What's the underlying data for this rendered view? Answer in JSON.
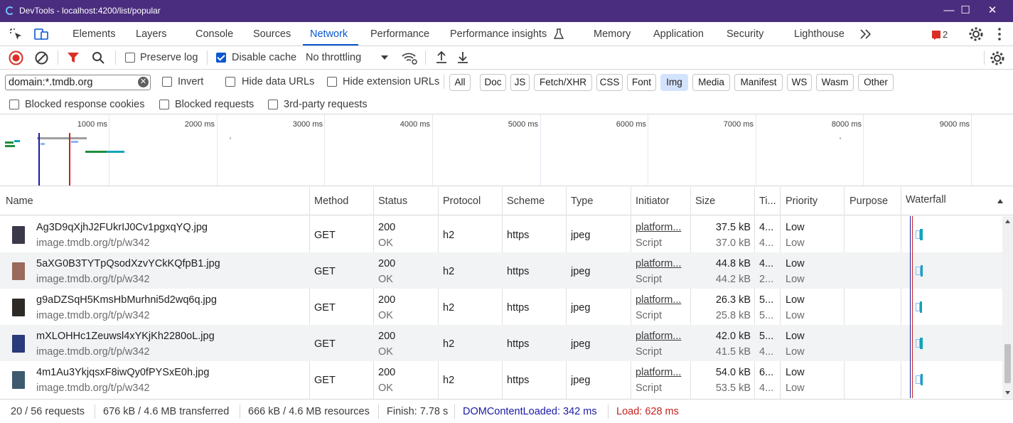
{
  "window": {
    "title": "DevTools - localhost:4200/list/popular",
    "minimize_glyph": "—",
    "maximize_glyph": "☐",
    "close_glyph": "✕"
  },
  "tabs": [
    "Elements",
    "Layers",
    "Console",
    "Sources",
    "Network",
    "Performance",
    "Performance insights",
    "Memory",
    "Application",
    "Security",
    "Lighthouse"
  ],
  "active_tab": "Network",
  "issues_count": "2",
  "toolbar": {
    "preserve_log": "Preserve log",
    "preserve_log_checked": false,
    "disable_cache": "Disable cache",
    "disable_cache_checked": true,
    "throttling": "No throttling"
  },
  "filter": {
    "value": "domain:*.tmdb.org",
    "invert": "Invert",
    "hide_data_urls": "Hide data URLs",
    "hide_extension_urls": "Hide extension URLs",
    "types": [
      "All",
      "Doc",
      "JS",
      "Fetch/XHR",
      "CSS",
      "Font",
      "Img",
      "Media",
      "Manifest",
      "WS",
      "Wasm",
      "Other"
    ],
    "active_type": "Img",
    "blocked_response_cookies": "Blocked response cookies",
    "blocked_requests": "Blocked requests",
    "third_party_requests": "3rd-party requests"
  },
  "overview": {
    "ticks": [
      "1000 ms",
      "2000 ms",
      "3000 ms",
      "4000 ms",
      "5000 ms",
      "6000 ms",
      "7000 ms",
      "8000 ms",
      "9000 ms"
    ],
    "dom_content_loaded_ms": 342,
    "load_ms": 628
  },
  "columns": [
    "Name",
    "Method",
    "Status",
    "Protocol",
    "Scheme",
    "Type",
    "Initiator",
    "Size",
    "Ti...",
    "Priority",
    "Purpose",
    "Waterfall"
  ],
  "requests": [
    {
      "name": "Ag3D9qXjhJ2FUkrIJ0Cv1pgxqYQ.jpg",
      "url": "image.tmdb.org/t/p/w342",
      "method": "GET",
      "status": "200",
      "status_text": "OK",
      "protocol": "h2",
      "scheme": "https",
      "type": "jpeg",
      "initiator": "platform...",
      "initiator_type": "Script",
      "size": "37.5 kB",
      "resource_size": "37.0 kB",
      "time": "4...",
      "time2": "4...",
      "priority": "Low",
      "priority2": "Low",
      "thumb_color": "#3a3a4a"
    },
    {
      "name": "5aXG0B3TYTpQsodXzvYCkKQfpB1.jpg",
      "url": "image.tmdb.org/t/p/w342",
      "method": "GET",
      "status": "200",
      "status_text": "OK",
      "protocol": "h2",
      "scheme": "https",
      "type": "jpeg",
      "initiator": "platform...",
      "initiator_type": "Script",
      "size": "44.8 kB",
      "resource_size": "44.2 kB",
      "time": "4...",
      "time2": "2...",
      "priority": "Low",
      "priority2": "Low",
      "thumb_color": "#9a6a5a"
    },
    {
      "name": "g9aDZSqH5KmsHbMurhni5d2wq6q.jpg",
      "url": "image.tmdb.org/t/p/w342",
      "method": "GET",
      "status": "200",
      "status_text": "OK",
      "protocol": "h2",
      "scheme": "https",
      "type": "jpeg",
      "initiator": "platform...",
      "initiator_type": "Script",
      "size": "26.3 kB",
      "resource_size": "25.8 kB",
      "time": "5...",
      "time2": "5...",
      "priority": "Low",
      "priority2": "Low",
      "thumb_color": "#2e2a26"
    },
    {
      "name": "mXLOHHc1Zeuwsl4xYKjKh2280oL.jpg",
      "url": "image.tmdb.org/t/p/w342",
      "method": "GET",
      "status": "200",
      "status_text": "OK",
      "protocol": "h2",
      "scheme": "https",
      "type": "jpeg",
      "initiator": "platform...",
      "initiator_type": "Script",
      "size": "42.0 kB",
      "resource_size": "41.5 kB",
      "time": "5...",
      "time2": "4...",
      "priority": "Low",
      "priority2": "Low",
      "thumb_color": "#2b3a7a"
    },
    {
      "name": "4m1Au3YkjqsxF8iwQy0fPYSxE0h.jpg",
      "url": "image.tmdb.org/t/p/w342",
      "method": "GET",
      "status": "200",
      "status_text": "OK",
      "protocol": "h2",
      "scheme": "https",
      "type": "jpeg",
      "initiator": "platform...",
      "initiator_type": "Script",
      "size": "54.0 kB",
      "resource_size": "53.5 kB",
      "time": "6...",
      "time2": "4...",
      "priority": "Low",
      "priority2": "Low",
      "thumb_color": "#3e5a6e"
    }
  ],
  "status": {
    "requests": "20 / 56 requests",
    "transferred": "676 kB / 4.6 MB transferred",
    "resources": "666 kB / 4.6 MB resources",
    "finish": "Finish: 7.78 s",
    "dom_content_loaded": "DOMContentLoaded: 342 ms",
    "load": "Load: 628 ms"
  },
  "colors": {
    "accent": "#0b57d0",
    "titlebar": "#4b2d7f",
    "record_red": "#d93025",
    "dcl_blue": "#1a1aa6",
    "load_red": "#c5221f"
  }
}
